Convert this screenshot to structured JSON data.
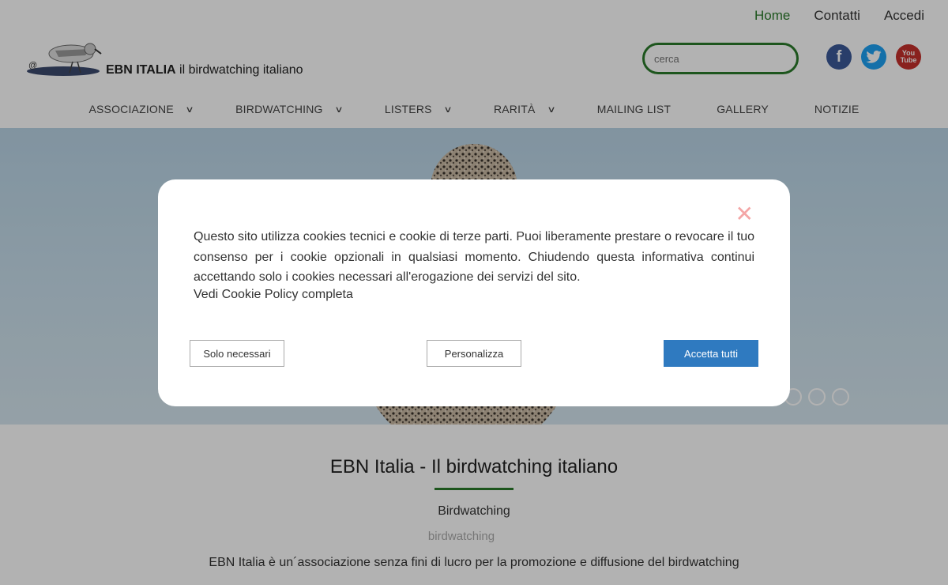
{
  "topnav": {
    "home": "Home",
    "contacts": "Contatti",
    "login": "Accedi"
  },
  "logo": {
    "brand": "EBN ITALIA",
    "tagline": "il birdwatching italiano",
    "at": "@"
  },
  "search": {
    "placeholder": "cerca"
  },
  "social": {
    "facebook": "f",
    "youtube_you": "You",
    "youtube_tube": "Tube"
  },
  "mainnav": [
    {
      "label": "ASSOCIAZIONE",
      "dropdown": true
    },
    {
      "label": "BIRDWATCHING",
      "dropdown": true
    },
    {
      "label": "LISTERS",
      "dropdown": true
    },
    {
      "label": "RARITÀ",
      "dropdown": true
    },
    {
      "label": "MAILING LIST",
      "dropdown": false
    },
    {
      "label": "GALLERY",
      "dropdown": false
    },
    {
      "label": "NOTIZIE",
      "dropdown": false
    }
  ],
  "content": {
    "title": "EBN Italia - Il birdwatching italiano",
    "subtitle": "Birdwatching",
    "tag": "birdwatching",
    "description": "EBN Italia è un´associazione senza fini di lucro per la promozione e diffusione del birdwatching"
  },
  "cookie_modal": {
    "text": "Questo sito utilizza cookies tecnici e cookie di terze parti. Puoi liberamente prestare o revocare il tuo consenso per i cookie opzionali in qualsiasi momento. Chiudendo questa informativa continui accettando solo i cookies necessari all'erogazione dei servizi del sito.",
    "policy_link": "Vedi Cookie Policy completa",
    "btn_necessary": "Solo necessari",
    "btn_customize": "Personalizza",
    "btn_accept": "Accetta tutti",
    "close": "✕"
  },
  "colors": {
    "accent_green": "#2a7a2a",
    "accept_blue": "#2f7ac0",
    "close_pink": "#f4a6a6"
  },
  "icons": [
    "search-icon",
    "facebook-icon",
    "twitter-icon",
    "youtube-icon",
    "chevron-down-icon",
    "close-icon"
  ]
}
